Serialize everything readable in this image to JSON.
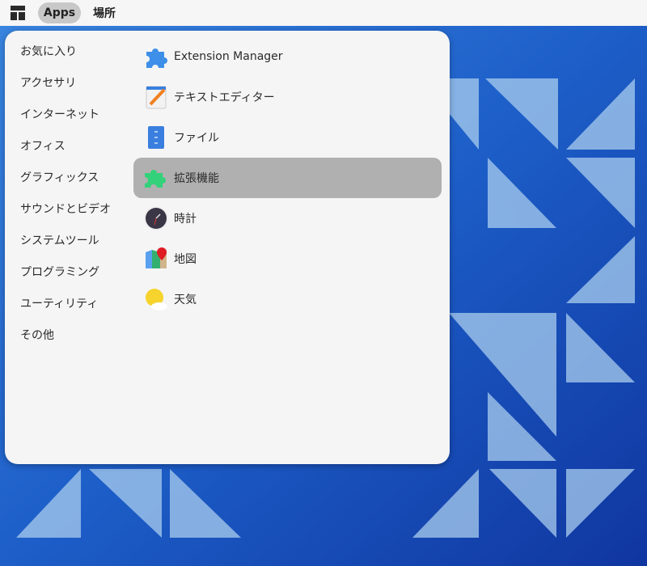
{
  "topbar": {
    "apps_label": "Apps",
    "places_label": "場所",
    "layout_icon": "layout-icon"
  },
  "categories": [
    "お気に入り",
    "アクセサリ",
    "インターネット",
    "オフィス",
    "グラフィックス",
    "サウンドとビデオ",
    "システムツール",
    "プログラミング",
    "ユーティリティ",
    "その他"
  ],
  "apps": [
    {
      "label": "Extension Manager",
      "icon": "puzzle-blue-icon"
    },
    {
      "label": "テキストエディター",
      "icon": "text-editor-icon"
    },
    {
      "label": "ファイル",
      "icon": "files-icon"
    },
    {
      "label": "拡張機能",
      "icon": "puzzle-green-icon",
      "selected": true
    },
    {
      "label": "時計",
      "icon": "clock-icon"
    },
    {
      "label": "地図",
      "icon": "maps-icon"
    },
    {
      "label": "天気",
      "icon": "weather-icon"
    }
  ],
  "colors": {
    "selected": "#b0b0b0",
    "panel": "#f5f5f5",
    "topbar": "#f6f6f6"
  }
}
